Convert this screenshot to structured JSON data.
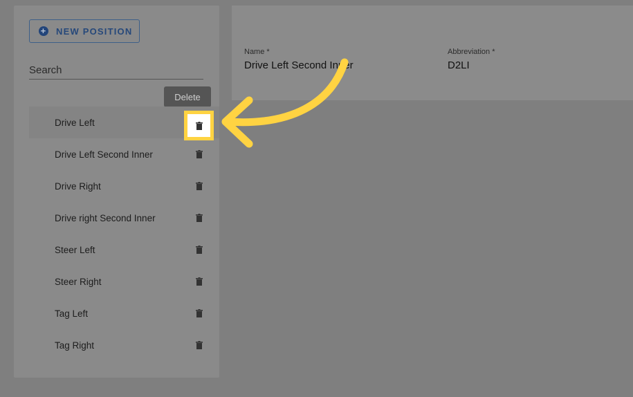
{
  "sidebar": {
    "new_button_label": "NEW POSITION",
    "search_placeholder": "Search",
    "tooltip": "Delete",
    "items": [
      {
        "label": "Drive Left"
      },
      {
        "label": "Drive Left Second Inner"
      },
      {
        "label": "Drive Right"
      },
      {
        "label": "Drive right Second Inner"
      },
      {
        "label": "Steer Left"
      },
      {
        "label": "Steer Right"
      },
      {
        "label": "Tag Left"
      },
      {
        "label": "Tag Right"
      }
    ],
    "selected_index": 0
  },
  "form": {
    "name_label": "Name *",
    "name_value": "Drive Left Second Inner",
    "abbr_label": "Abbreviation *",
    "abbr_value": "D2LI"
  },
  "colors": {
    "accent": "#26487a",
    "highlight": "#ffd342"
  },
  "icons": {
    "new": "plus-circle-icon",
    "delete": "trash-icon",
    "callout": "curved-arrow-icon"
  }
}
